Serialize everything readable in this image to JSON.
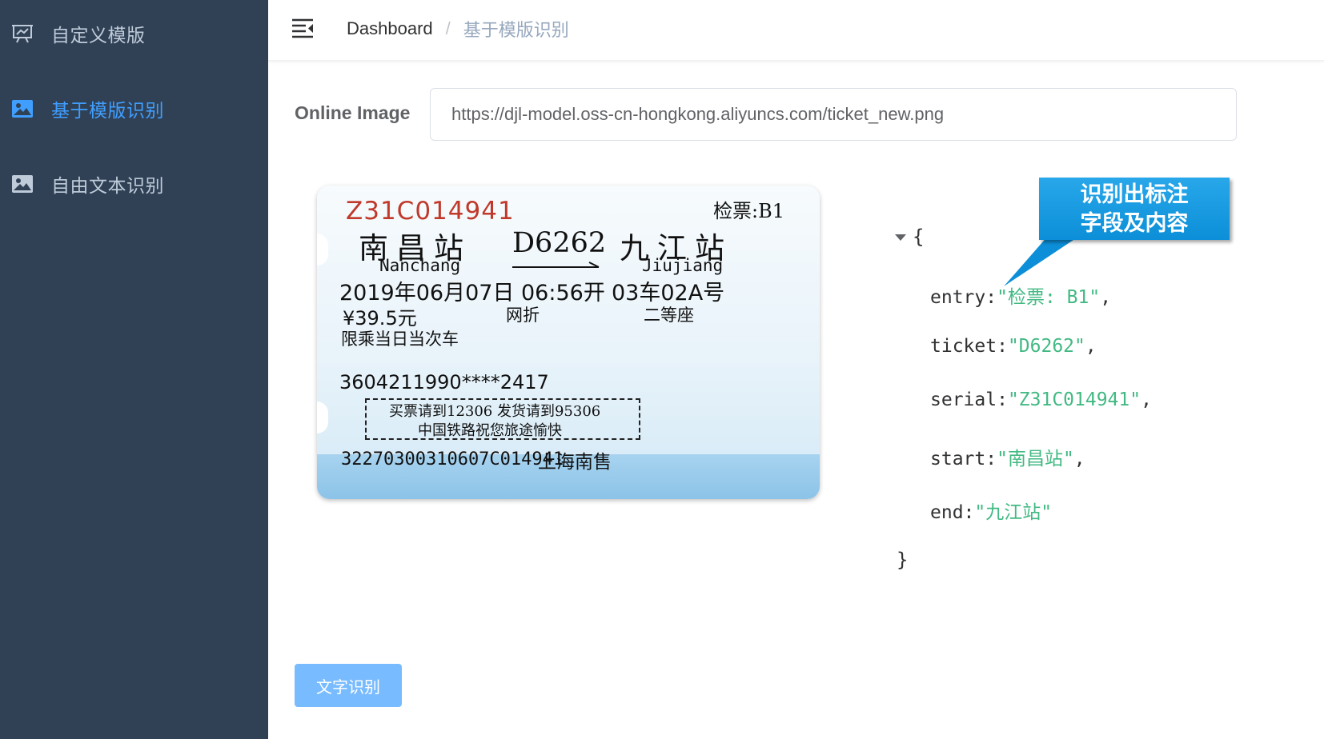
{
  "sidebar": {
    "items": [
      {
        "label": "自定义模版",
        "icon": "presentation-chart-icon"
      },
      {
        "label": "基于模版识别",
        "icon": "image-icon",
        "active": true
      },
      {
        "label": "自由文本识别",
        "icon": "image-icon"
      }
    ]
  },
  "header": {
    "menu_icon": "hamburger-menu-icon",
    "breadcrumb": {
      "home": "Dashboard",
      "separator": "/",
      "current": "基于模版识别"
    }
  },
  "form": {
    "label": "Online Image",
    "url_value": "https://djl-model.oss-cn-hongkong.aliyuncs.com/ticket_new.png"
  },
  "ticket": {
    "serial": "Z31C014941",
    "entry": "检票:B1",
    "start": "南昌站",
    "train": "D6262",
    "end": "九江站",
    "start_en": "Nanchang",
    "end_en": "Jiujiang",
    "date": "2019年06月07日 06:56开",
    "seat": "03车02A号",
    "price": "¥39.5元",
    "discount": "网折",
    "class": "二等座",
    "limit": "限乘当日当次车",
    "id": "3604211990****2417",
    "notice1": "买票请到12306 发货请到95306",
    "notice2": "中国铁路祝您旅途愉快",
    "code": "32270300310607C014941",
    "station": "上海南售"
  },
  "result": {
    "open": "{",
    "close": "}",
    "rows": [
      {
        "key": "entry:",
        "value": "\"检票: B1\"",
        "comma": ","
      },
      {
        "key": "ticket:",
        "value": "\"D6262\"",
        "comma": ","
      },
      {
        "key": "serial:",
        "value": "\"Z31C014941\"",
        "comma": ","
      },
      {
        "key": "start:",
        "value": "\"南昌站\"",
        "comma": ","
      },
      {
        "key": "end:",
        "value": "\"九江站\"",
        "comma": ""
      }
    ]
  },
  "callout": {
    "line1": "识别出标注",
    "line2": "字段及内容"
  },
  "button": {
    "label": "文字识别"
  },
  "colors": {
    "sidebar_bg": "#304156",
    "accent": "#409eff",
    "json_value": "#42b983",
    "callout": "#169be3"
  }
}
